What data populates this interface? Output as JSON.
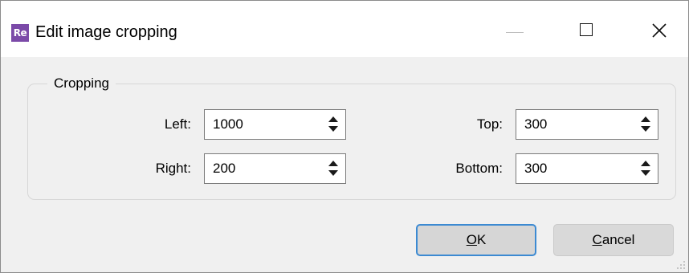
{
  "window": {
    "title": "Edit image cropping",
    "app_icon_text": "Re",
    "controls": {
      "minimize_icon": "minimize-icon",
      "maximize_icon": "maximize-icon",
      "close_icon": "close-icon"
    }
  },
  "cropping": {
    "group_label": "Cropping",
    "left": {
      "label": "Left:",
      "value": "1000"
    },
    "right": {
      "label": "Right:",
      "value": "200"
    },
    "top": {
      "label": "Top:",
      "value": "300"
    },
    "bottom": {
      "label": "Bottom:",
      "value": "300"
    }
  },
  "buttons": {
    "ok": {
      "mnemonic": "O",
      "rest": "K"
    },
    "cancel": {
      "mnemonic": "C",
      "rest": "ancel"
    }
  },
  "colors": {
    "app_icon_bg": "#7b4aa8",
    "default_button_border": "#3c8ad2"
  }
}
